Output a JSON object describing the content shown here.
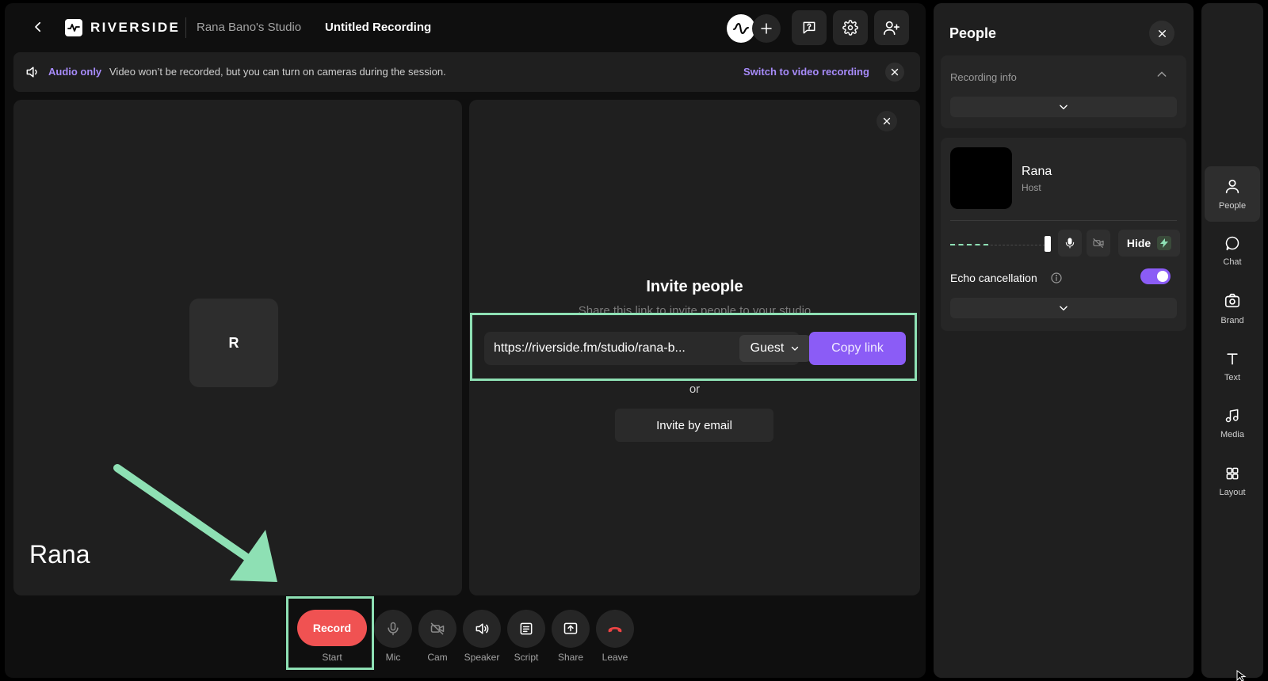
{
  "header": {
    "brand": "RIVERSIDE",
    "studio_name": "Rana Bano's Studio",
    "recording_title": "Untitled Recording"
  },
  "banner": {
    "mode_label": "Audio only",
    "message": "Video won’t be recorded, but you can turn on cameras during the session.",
    "switch_label": "Switch to video recording"
  },
  "tile": {
    "initial": "R",
    "name": "Rana"
  },
  "invite": {
    "title": "Invite people",
    "subtitle": "Share this link to invite people to your studio",
    "link": "https://riverside.fm/studio/rana-b...",
    "role": "Guest",
    "copy_label": "Copy link",
    "or_label": "or",
    "email_label": "Invite by email"
  },
  "controls": {
    "record_label": "Record",
    "start_label": "Start",
    "items": [
      {
        "label": "Mic",
        "icon": "mic-icon"
      },
      {
        "label": "Cam",
        "icon": "cam-off-icon"
      },
      {
        "label": "Speaker",
        "icon": "speaker-icon"
      },
      {
        "label": "Script",
        "icon": "script-icon"
      },
      {
        "label": "Share",
        "icon": "share-icon"
      },
      {
        "label": "Leave",
        "icon": "phone-hangup-icon"
      }
    ]
  },
  "people_panel": {
    "title": "People",
    "recording_info_label": "Recording info",
    "person": {
      "name": "Rana",
      "role": "Host",
      "hide_label": "Hide"
    },
    "echo_label": "Echo cancellation",
    "echo_enabled": true,
    "mic_level": 0.4
  },
  "rail": {
    "items": [
      {
        "label": "People",
        "icon": "people-icon",
        "active": true
      },
      {
        "label": "Chat",
        "icon": "chat-icon",
        "active": false
      },
      {
        "label": "Brand",
        "icon": "brand-icon",
        "active": false
      },
      {
        "label": "Text",
        "icon": "text-icon",
        "active": false
      },
      {
        "label": "Media",
        "icon": "media-icon",
        "active": false
      },
      {
        "label": "Layout",
        "icon": "layout-icon",
        "active": false
      }
    ]
  },
  "colors": {
    "accent": "#8b5cf6",
    "accent_text": "#a78bfa",
    "record": "#f05252",
    "leave": "#ef4444",
    "highlight": "#8ee0b4"
  }
}
